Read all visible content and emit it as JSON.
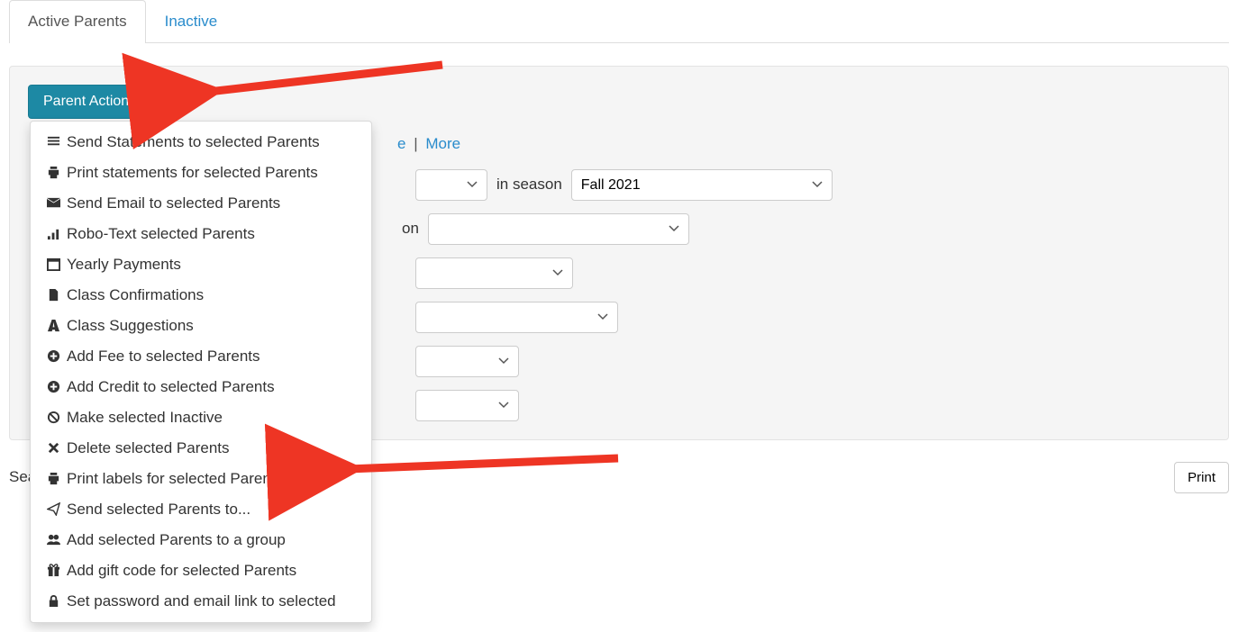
{
  "tabs": {
    "active": "Active Parents",
    "inactive": "Inactive"
  },
  "dropdown": {
    "label": "Parent Actions",
    "items": [
      {
        "icon": "list",
        "label": "Send Statements to selected Parents"
      },
      {
        "icon": "print",
        "label": "Print statements for selected Parents"
      },
      {
        "icon": "envelope",
        "label": "Send Email to selected Parents"
      },
      {
        "icon": "signal",
        "label": "Robo-Text selected Parents"
      },
      {
        "icon": "calendar",
        "label": "Yearly Payments"
      },
      {
        "icon": "file",
        "label": "Class Confirmations"
      },
      {
        "icon": "road",
        "label": "Class Suggestions"
      },
      {
        "icon": "plus-circle",
        "label": "Add Fee to selected Parents"
      },
      {
        "icon": "plus-circle",
        "label": "Add Credit to selected Parents"
      },
      {
        "icon": "ban",
        "label": "Make selected Inactive"
      },
      {
        "icon": "times",
        "label": "Delete selected Parents"
      },
      {
        "icon": "print",
        "label": "Print labels for selected Parents"
      },
      {
        "icon": "paper-plane",
        "label": "Send selected Parents to..."
      },
      {
        "icon": "users",
        "label": "Add selected Parents to a group"
      },
      {
        "icon": "gift",
        "label": "Add gift code for selected Parents"
      },
      {
        "icon": "lock",
        "label": "Set password and email link to selected"
      }
    ]
  },
  "links": {
    "partial": "e",
    "more": "More"
  },
  "filters": {
    "in_season_label": "in season",
    "season_value": "Fall 2021",
    "on_label_suffix": "on"
  },
  "footer": {
    "sea_prefix": "Sea",
    "print": "Print"
  }
}
